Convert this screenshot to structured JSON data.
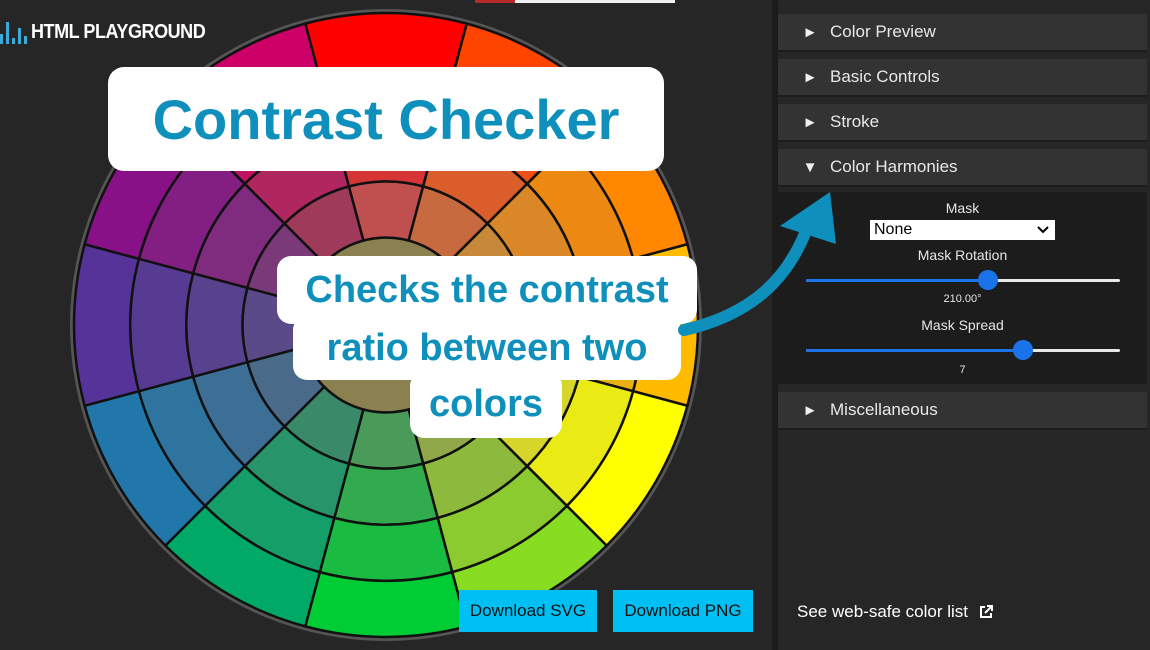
{
  "logo": {
    "text": "HTML PLAYGROUND"
  },
  "banner": {
    "title": "Contrast Checker",
    "callout_lines": [
      "Checks the contrast",
      "ratio between two",
      "colors"
    ]
  },
  "wheel": {
    "rings": 4,
    "segments": 12,
    "outer_colors": [
      "#ff0000",
      "#ff4400",
      "#ff8800",
      "#ffbb00",
      "#ffff00",
      "#88dd22",
      "#00cc33",
      "#00aa66",
      "#2277aa",
      "#553399",
      "#881188",
      "#cc0066"
    ],
    "inner_colors": [
      "#c05050",
      "#c86a40",
      "#c8883a",
      "#bba040",
      "#c0c040",
      "#90a84a",
      "#4a9a5a",
      "#3a8a6a",
      "#4a6a8a",
      "#5a4a88",
      "#7a3a7a",
      "#a03a5a"
    ]
  },
  "buttons": {
    "download_svg": "Download SVG",
    "download_png": "Download PNG"
  },
  "panel": {
    "sections": [
      {
        "label": "Color Preview",
        "expanded": false
      },
      {
        "label": "Basic Controls",
        "expanded": false
      },
      {
        "label": "Stroke",
        "expanded": false
      },
      {
        "label": "Color Harmonies",
        "expanded": true
      },
      {
        "label": "Miscellaneous",
        "expanded": false
      }
    ],
    "collapsed_arrow": "►",
    "expanded_arrow": "▼",
    "mask_label": "Mask",
    "mask_value": "None",
    "mask_rotation_label": "Mask Rotation",
    "mask_rotation_value": "210.00°",
    "mask_rotation_fraction": 0.58,
    "mask_spread_label": "Mask Spread",
    "mask_spread_value": "7",
    "mask_spread_fraction": 0.69,
    "websafe_link": "See web-safe color list"
  },
  "colors": {
    "accent": "#0e8fbc",
    "button_bg": "#00bff3",
    "slider": "#1a73e8"
  }
}
